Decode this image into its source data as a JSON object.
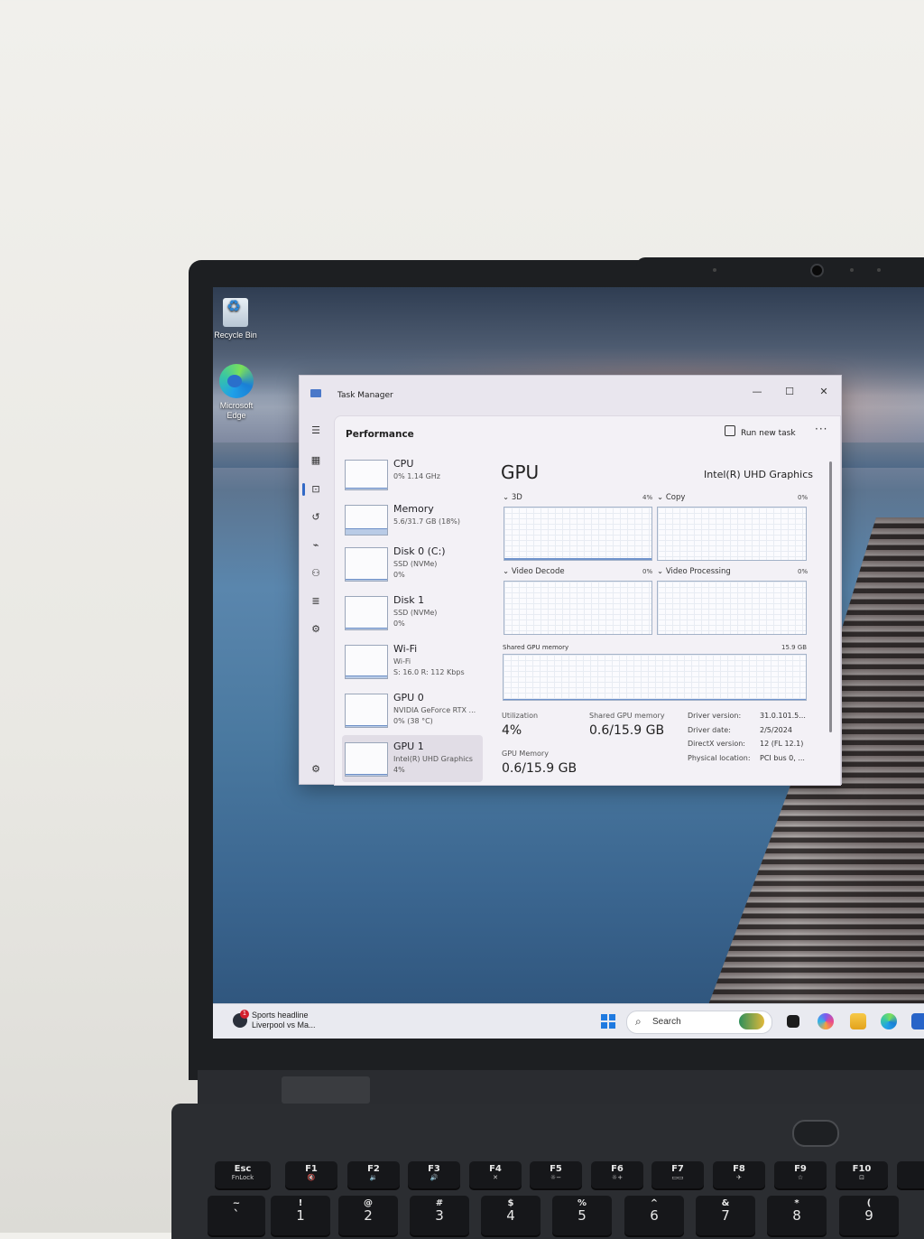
{
  "desktop": {
    "icons": [
      {
        "label": "Recycle Bin",
        "icon": "recycle-bin-icon"
      },
      {
        "label": "Microsoft Edge",
        "icon": "edge-icon"
      }
    ]
  },
  "task_manager": {
    "title": "Task Manager",
    "window_controls": {
      "minimize": "—",
      "maximize": "☐",
      "close": "✕"
    },
    "nav_icons": [
      "hamburger-icon",
      "processes-icon",
      "performance-icon",
      "app-history-icon",
      "startup-icon",
      "users-icon",
      "details-icon",
      "services-icon",
      "settings-icon"
    ],
    "header": {
      "title": "Performance",
      "run_new_task": "Run new task",
      "more": "···"
    },
    "devices": [
      {
        "name": "CPU",
        "sub1": "0% 1.14 GHz",
        "sub2": "",
        "usage": 0.02
      },
      {
        "name": "Memory",
        "sub1": "5.6/31.7 GB (18%)",
        "sub2": "",
        "usage": 0.18
      },
      {
        "name": "Disk 0 (C:)",
        "sub1": "SSD (NVMe)",
        "sub2": "0%",
        "usage": 0.0
      },
      {
        "name": "Disk 1",
        "sub1": "SSD (NVMe)",
        "sub2": "0%",
        "usage": 0.0
      },
      {
        "name": "Wi-Fi",
        "sub1": "Wi-Fi",
        "sub2": "S: 16.0 R: 112 Kbps",
        "usage": 0.05
      },
      {
        "name": "GPU 0",
        "sub1": "NVIDIA GeForce RTX ...",
        "sub2": "0% (38 °C)",
        "usage": 0.0
      },
      {
        "name": "GPU 1",
        "sub1": "Intel(R) UHD Graphics",
        "sub2": "4%",
        "usage": 0.04
      }
    ],
    "gpu": {
      "title": "GPU",
      "model": "Intel(R) UHD Graphics",
      "graphs": {
        "g3d": {
          "label": "3D",
          "pct": "4%"
        },
        "copy": {
          "label": "Copy",
          "pct": "0%"
        },
        "video_decode": {
          "label": "Video Decode",
          "pct": "0%"
        },
        "video_processing": {
          "label": "Video Processing",
          "pct": "0%"
        },
        "shared_memory": {
          "label": "Shared GPU memory",
          "max": "15.9 GB"
        }
      },
      "stats": {
        "utilization_label": "Utilization",
        "utilization_value": "4%",
        "shared_label": "Shared GPU memory",
        "shared_value": "0.6/15.9 GB",
        "gpu_memory_label": "GPU Memory",
        "gpu_memory_value": "0.6/15.9 GB"
      },
      "properties": [
        {
          "label": "Driver version:",
          "value": "31.0.101.5..."
        },
        {
          "label": "Driver date:",
          "value": "2/5/2024"
        },
        {
          "label": "DirectX version:",
          "value": "12 (FL 12.1)"
        },
        {
          "label": "Physical location:",
          "value": "PCI bus 0, ..."
        }
      ]
    }
  },
  "taskbar": {
    "widget_line1": "Sports headline",
    "widget_line2": "Liverpool vs Ma...",
    "widget_badge": "1",
    "search_placeholder": "Search",
    "apps": [
      "start-icon",
      "copilot-icon",
      "file-explorer-icon",
      "edge-icon",
      "store-icon"
    ]
  },
  "keyboard": {
    "fn_row": [
      {
        "top": "Esc",
        "sub": "FnLock"
      },
      {
        "top": "F1",
        "sub": "🔇"
      },
      {
        "top": "F2",
        "sub": "🔉"
      },
      {
        "top": "F3",
        "sub": "🔊"
      },
      {
        "top": "F4",
        "sub": "✕"
      },
      {
        "top": "F5",
        "sub": "☼−"
      },
      {
        "top": "F6",
        "sub": "☼+"
      },
      {
        "top": "F7",
        "sub": "▭▭"
      },
      {
        "top": "F8",
        "sub": "✈"
      },
      {
        "top": "F9",
        "sub": "☆"
      },
      {
        "top": "F10",
        "sub": "⊡"
      }
    ],
    "num_row": [
      {
        "top": "~",
        "big": "`"
      },
      {
        "top": "!",
        "big": "1"
      },
      {
        "top": "@",
        "big": "2"
      },
      {
        "top": "#",
        "big": "3"
      },
      {
        "top": "$",
        "big": "4"
      },
      {
        "top": "%",
        "big": "5"
      },
      {
        "top": "^",
        "big": "6"
      },
      {
        "top": "&",
        "big": "7"
      },
      {
        "top": "*",
        "big": "8"
      },
      {
        "top": "(",
        "big": "9"
      }
    ]
  }
}
